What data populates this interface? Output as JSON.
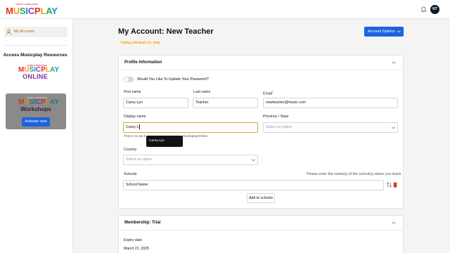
{
  "header": {
    "logo_small": "THIRD & BRIGHTER",
    "logo_text": "MUSICPLAY",
    "avatar_initials": "NT"
  },
  "sidebar": {
    "active_item": "My Account",
    "resources_title": "Access Musicplay Resources",
    "online_small": "THIRD & BRIGHTER",
    "online_logo": "MUSICPLAY",
    "online_word": "ONLINE",
    "workshops_small": "THIRD & BRIGHTER",
    "workshops_logo": "MUSICPLAY",
    "workshops_word": "Workshops",
    "activate_label": "Activate now"
  },
  "page": {
    "title": "My Account: New Teacher",
    "trial_badge": "Trialing until March 21, 2025",
    "options_button": "Account Options"
  },
  "profile": {
    "section_title": "Profile Information",
    "toggle_label": "Would You Like To Update Your Password?",
    "first_name_label": "First name",
    "first_name_value": "Carey-Lyn",
    "last_name_label": "Last name",
    "last_name_value": "Teacher",
    "email_label": "Email",
    "email_required": "*",
    "email_value": "newteacher@music.com",
    "display_name_label": "Display name",
    "display_name_value": "Carey-L",
    "autocomplete_suggestion": "Carey-Lyn",
    "display_help_start": "This is so we k",
    "display_help_end": "MusicplayOnline",
    "province_label": "Province / State",
    "province_placeholder": "Select an option",
    "country_label": "Country",
    "country_placeholder": "Select an option",
    "schools_label": "Schools",
    "schools_hint": "Please enter the name(s) of the school(s) where you teach",
    "school_placeholder": "School Name",
    "add_schools_button": "Add to schools"
  },
  "membership": {
    "section_title": "Membership: Trial",
    "expiry_label": "Expiry date",
    "expiry_value": "March 21, 2025"
  },
  "colors": {
    "primary": "#1d62e0",
    "accent": "#b36a00",
    "focus_border": "#d9a14a",
    "danger": "#d93025"
  },
  "icons": [
    "bell-icon",
    "user-icon",
    "chevron-down-icon",
    "chevron-up-icon",
    "sort-icon",
    "trash-icon"
  ]
}
